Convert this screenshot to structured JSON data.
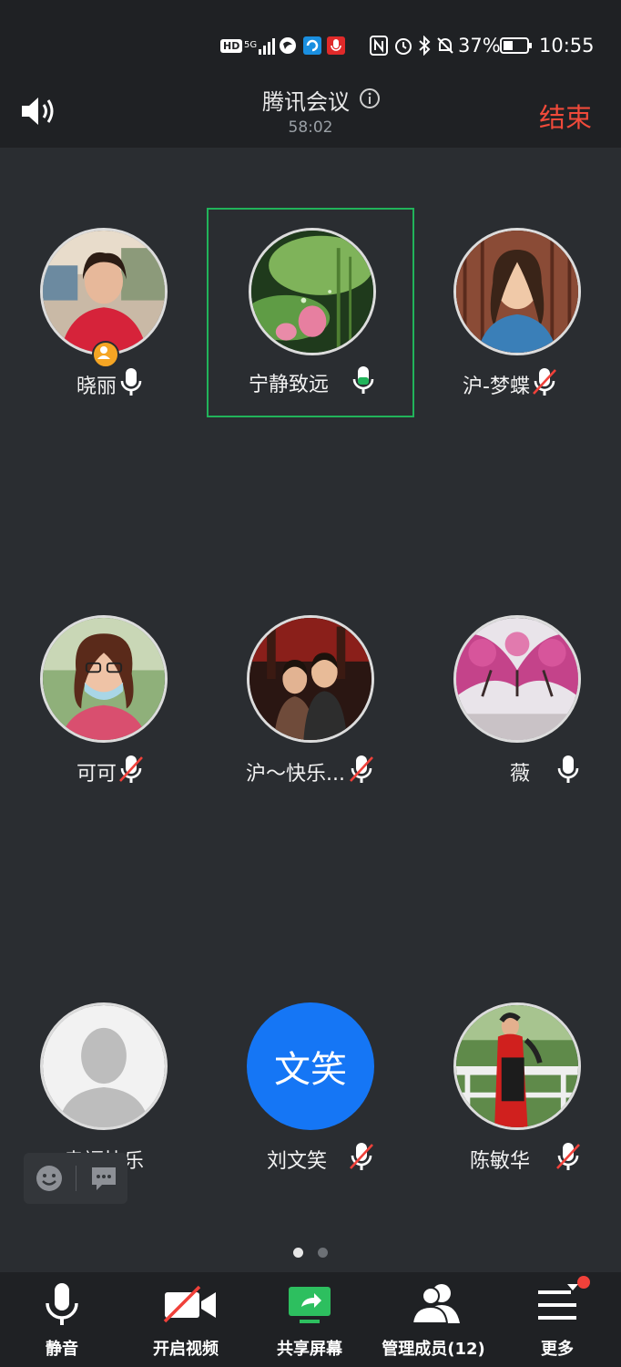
{
  "status_bar": {
    "hd": "HD",
    "network": "5G",
    "battery": "37%",
    "time": "10:55"
  },
  "header": {
    "title": "腾讯会议",
    "timer": "58:02",
    "end_label": "结束"
  },
  "participants": [
    {
      "name": "晓丽",
      "mic": "on",
      "host": true
    },
    {
      "name": "宁静致远",
      "mic": "speaking",
      "active": true
    },
    {
      "name": "沪-梦蝶",
      "mic": "muted"
    },
    {
      "name": "可可",
      "mic": "muted"
    },
    {
      "name": "沪～快乐...",
      "mic": "muted"
    },
    {
      "name": "薇",
      "mic": "on"
    },
    {
      "name": "幸福快乐",
      "mic": "none"
    },
    {
      "name": "刘文笑",
      "mic": "muted",
      "initials": "文笑"
    },
    {
      "name": "陈敏华",
      "mic": "muted"
    }
  ],
  "pager": {
    "pages": 2,
    "current": 1
  },
  "toolbar": {
    "mute": "静音",
    "video": "开启视频",
    "share": "共享屏幕",
    "members": "管理成员(12)",
    "more": "更多"
  },
  "colors": {
    "accent_green": "#21b35a",
    "end_red": "#f04a3a",
    "initials_blue": "#1576f5",
    "background": "#2a2d31"
  }
}
